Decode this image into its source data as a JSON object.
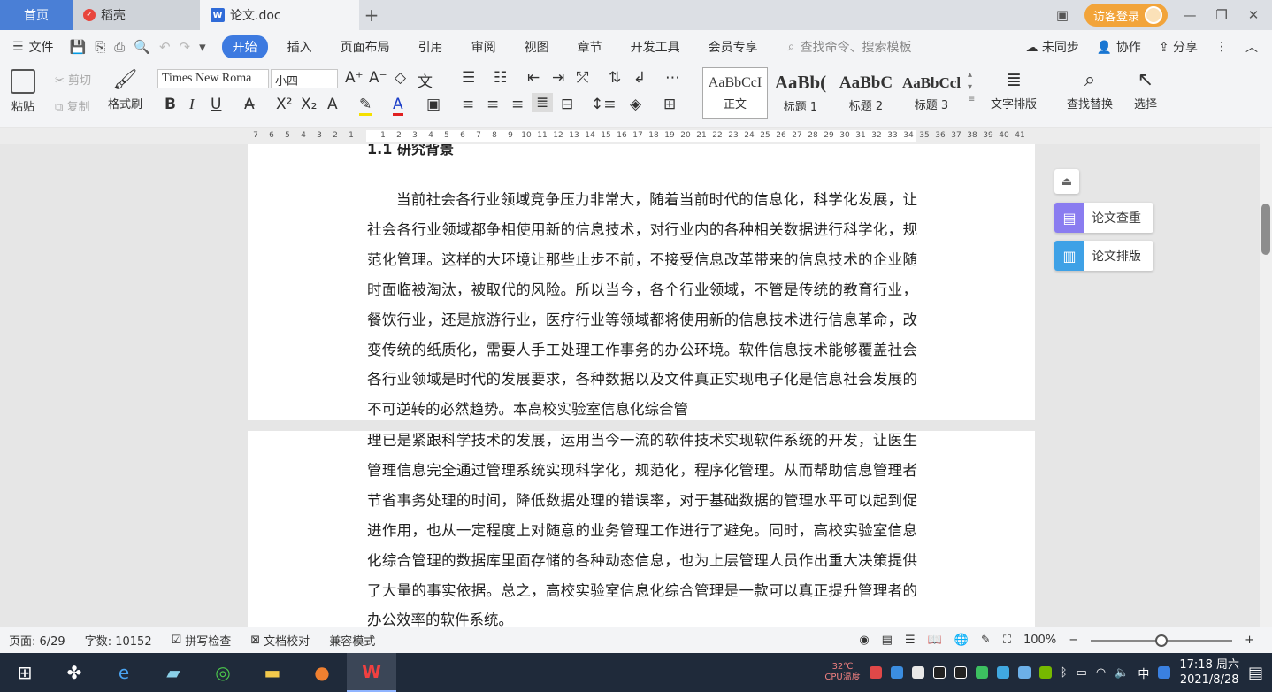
{
  "tabs": {
    "home": "首页",
    "daoke": "稻壳",
    "doc": "论文.doc"
  },
  "titlebar": {
    "login": "访客登录"
  },
  "menu": {
    "file": "文件",
    "items": [
      "开始",
      "插入",
      "页面布局",
      "引用",
      "审阅",
      "视图",
      "章节",
      "开发工具",
      "会员专享"
    ],
    "search_placeholder": "查找命令、搜索模板",
    "sync": "未同步",
    "collab": "协作",
    "share": "分享"
  },
  "ribbon": {
    "paste": "粘贴",
    "cut": "剪切",
    "copy": "复制",
    "format_painter": "格式刷",
    "font_name": "Times New Roma",
    "font_size": "小四",
    "styles": [
      {
        "preview": "AaBbCcI",
        "label": "正文"
      },
      {
        "preview": "AaBb(",
        "label": "标题 1"
      },
      {
        "preview": "AaBbC",
        "label": "标题 2"
      },
      {
        "preview": "AaBbCcl",
        "label": "标题 3"
      }
    ],
    "text_layout": "文字排版",
    "find_replace": "查找替换",
    "select": "选择"
  },
  "ruler": {
    "numbers": [
      "7",
      "6",
      "5",
      "4",
      "3",
      "2",
      "1",
      "",
      "1",
      "2",
      "3",
      "4",
      "5",
      "6",
      "7",
      "8",
      "9",
      "10",
      "11",
      "12",
      "13",
      "14",
      "15",
      "16",
      "17",
      "18",
      "19",
      "20",
      "21",
      "22",
      "23",
      "24",
      "25",
      "26",
      "27",
      "28",
      "29",
      "30",
      "31",
      "32",
      "33",
      "34",
      "35",
      "36",
      "37",
      "38",
      "39",
      "40",
      "41"
    ]
  },
  "document": {
    "heading": "1.1  研究背景",
    "page1_text": "当前社会各行业领域竞争压力非常大，随着当前时代的信息化，科学化发展，让社会各行业领域都争相使用新的信息技术，对行业内的各种相关数据进行科学化，规范化管理。这样的大环境让那些止步不前，不接受信息改革带来的信息技术的企业随时面临被淘汰，被取代的风险。所以当今，各个行业领域，不管是传统的教育行业，餐饮行业，还是旅游行业，医疗行业等领域都将使用新的信息技术进行信息革命，改变传统的纸质化，需要人手工处理工作事务的办公环境。软件信息技术能够覆盖社会各行业领域是时代的发展要求，各种数据以及文件真正实现电子化是信息社会发展的不可逆转的必然趋势。本高校实验室信息化综合管",
    "page2_text": "理已是紧跟科学技术的发展，运用当今一流的软件技术实现软件系统的开发，让医生管理信息完全通过管理系统实现科学化，规范化，程序化管理。从而帮助信息管理者节省事务处理的时间，降低数据处理的错误率，对于基础数据的管理水平可以起到促进作用，也从一定程度上对随意的业务管理工作进行了避免。同时，高校实验室信息化综合管理的数据库里面存储的各种动态信息，也为上层管理人员作出重大决策提供了大量的事实依据。总之，高校实验室信息化综合管理是一款可以真正提升管理者的办公效率的软件系统。"
  },
  "side_panel": {
    "check": "论文查重",
    "layout": "论文排版"
  },
  "statusbar": {
    "page": "页面: 6/29",
    "words": "字数: 10152",
    "spell": "拼写检查",
    "proof": "文档校对",
    "compat": "兼容模式",
    "zoom": "100%",
    "zoom_level": 0.5
  },
  "taskbar": {
    "temp": "32℃",
    "cpu": "CPU温度",
    "ime": "中",
    "time": "17:18 周六",
    "date": "2021/8/28"
  },
  "colors": {
    "accent": "#3d7ae0",
    "home_tab": "#4a7fd6",
    "login": "#f2a43a",
    "check_icon": "#8a7cf0",
    "layout_icon": "#3ea1e6"
  }
}
